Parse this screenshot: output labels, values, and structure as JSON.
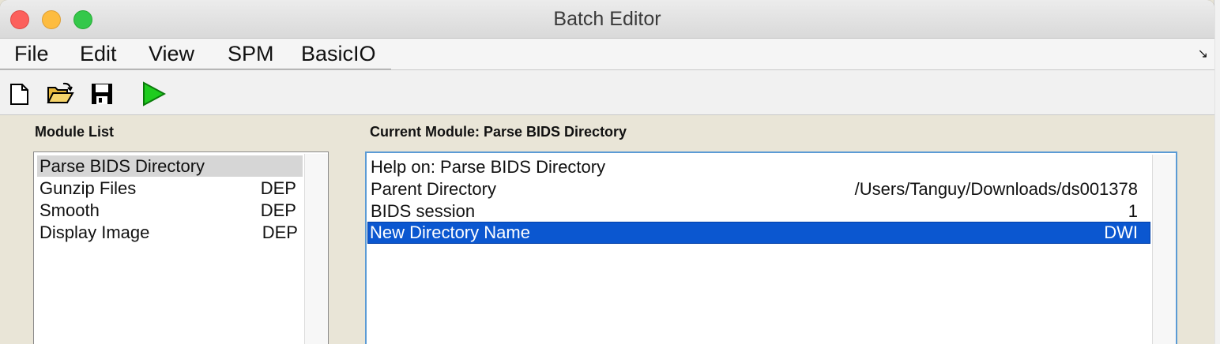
{
  "window": {
    "title": "Batch Editor"
  },
  "menu": {
    "items": [
      {
        "label": "File"
      },
      {
        "label": "Edit"
      },
      {
        "label": "View"
      },
      {
        "label": "SPM"
      },
      {
        "label": "BasicIO"
      }
    ],
    "corner_glyph": "↘"
  },
  "toolbar": {
    "buttons": [
      {
        "icon": "new-file-icon"
      },
      {
        "icon": "open-folder-icon"
      },
      {
        "icon": "save-icon"
      },
      {
        "icon": "run-icon",
        "color": "#1fcc1f"
      }
    ]
  },
  "module_list": {
    "label": "Module List",
    "items": [
      {
        "name": "Parse BIDS Directory",
        "tag": "",
        "selected": true
      },
      {
        "name": "Gunzip Files",
        "tag": "DEP"
      },
      {
        "name": "Smooth",
        "tag": "DEP"
      },
      {
        "name": "Display Image",
        "tag": "DEP"
      }
    ]
  },
  "current_module": {
    "label": "Current Module: Parse BIDS Directory",
    "rows": [
      {
        "name": "Help on: Parse BIDS Directory",
        "value": ""
      },
      {
        "name": "Parent Directory",
        "value": "/Users/Tanguy/Downloads/ds001378"
      },
      {
        "name": "BIDS session",
        "value": "1"
      },
      {
        "name": "New Directory Name",
        "value": "DWI",
        "selected": true
      }
    ]
  },
  "colors": {
    "selection_blue": "#0b57d0",
    "selection_gray": "#d6d6d6",
    "panel_bg": "#e9e5d7"
  }
}
